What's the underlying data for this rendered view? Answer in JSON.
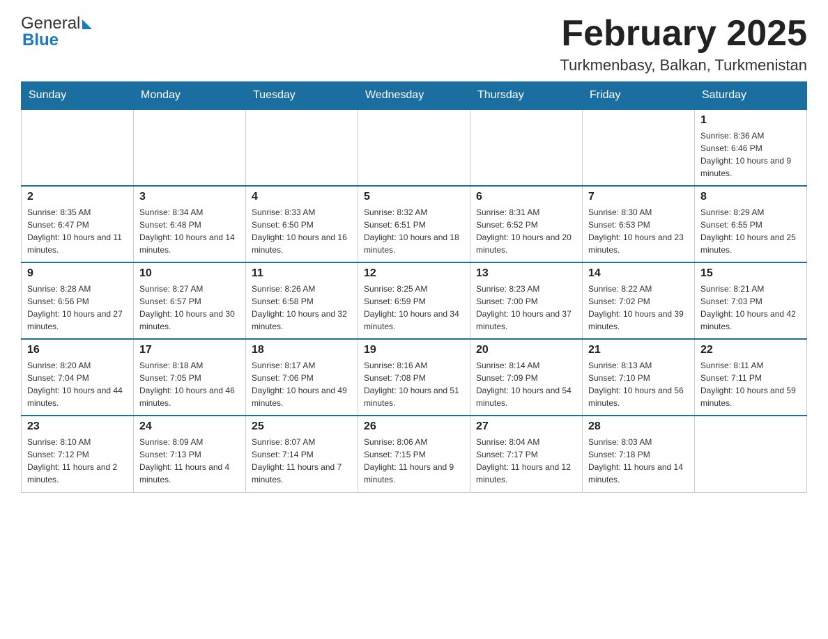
{
  "header": {
    "logo_general": "General",
    "logo_blue": "Blue",
    "month_title": "February 2025",
    "location": "Turkmenbasy, Balkan, Turkmenistan"
  },
  "weekdays": [
    "Sunday",
    "Monday",
    "Tuesday",
    "Wednesday",
    "Thursday",
    "Friday",
    "Saturday"
  ],
  "weeks": [
    [
      {
        "day": "",
        "info": ""
      },
      {
        "day": "",
        "info": ""
      },
      {
        "day": "",
        "info": ""
      },
      {
        "day": "",
        "info": ""
      },
      {
        "day": "",
        "info": ""
      },
      {
        "day": "",
        "info": ""
      },
      {
        "day": "1",
        "info": "Sunrise: 8:36 AM\nSunset: 6:46 PM\nDaylight: 10 hours and 9 minutes."
      }
    ],
    [
      {
        "day": "2",
        "info": "Sunrise: 8:35 AM\nSunset: 6:47 PM\nDaylight: 10 hours and 11 minutes."
      },
      {
        "day": "3",
        "info": "Sunrise: 8:34 AM\nSunset: 6:48 PM\nDaylight: 10 hours and 14 minutes."
      },
      {
        "day": "4",
        "info": "Sunrise: 8:33 AM\nSunset: 6:50 PM\nDaylight: 10 hours and 16 minutes."
      },
      {
        "day": "5",
        "info": "Sunrise: 8:32 AM\nSunset: 6:51 PM\nDaylight: 10 hours and 18 minutes."
      },
      {
        "day": "6",
        "info": "Sunrise: 8:31 AM\nSunset: 6:52 PM\nDaylight: 10 hours and 20 minutes."
      },
      {
        "day": "7",
        "info": "Sunrise: 8:30 AM\nSunset: 6:53 PM\nDaylight: 10 hours and 23 minutes."
      },
      {
        "day": "8",
        "info": "Sunrise: 8:29 AM\nSunset: 6:55 PM\nDaylight: 10 hours and 25 minutes."
      }
    ],
    [
      {
        "day": "9",
        "info": "Sunrise: 8:28 AM\nSunset: 6:56 PM\nDaylight: 10 hours and 27 minutes."
      },
      {
        "day": "10",
        "info": "Sunrise: 8:27 AM\nSunset: 6:57 PM\nDaylight: 10 hours and 30 minutes."
      },
      {
        "day": "11",
        "info": "Sunrise: 8:26 AM\nSunset: 6:58 PM\nDaylight: 10 hours and 32 minutes."
      },
      {
        "day": "12",
        "info": "Sunrise: 8:25 AM\nSunset: 6:59 PM\nDaylight: 10 hours and 34 minutes."
      },
      {
        "day": "13",
        "info": "Sunrise: 8:23 AM\nSunset: 7:00 PM\nDaylight: 10 hours and 37 minutes."
      },
      {
        "day": "14",
        "info": "Sunrise: 8:22 AM\nSunset: 7:02 PM\nDaylight: 10 hours and 39 minutes."
      },
      {
        "day": "15",
        "info": "Sunrise: 8:21 AM\nSunset: 7:03 PM\nDaylight: 10 hours and 42 minutes."
      }
    ],
    [
      {
        "day": "16",
        "info": "Sunrise: 8:20 AM\nSunset: 7:04 PM\nDaylight: 10 hours and 44 minutes."
      },
      {
        "day": "17",
        "info": "Sunrise: 8:18 AM\nSunset: 7:05 PM\nDaylight: 10 hours and 46 minutes."
      },
      {
        "day": "18",
        "info": "Sunrise: 8:17 AM\nSunset: 7:06 PM\nDaylight: 10 hours and 49 minutes."
      },
      {
        "day": "19",
        "info": "Sunrise: 8:16 AM\nSunset: 7:08 PM\nDaylight: 10 hours and 51 minutes."
      },
      {
        "day": "20",
        "info": "Sunrise: 8:14 AM\nSunset: 7:09 PM\nDaylight: 10 hours and 54 minutes."
      },
      {
        "day": "21",
        "info": "Sunrise: 8:13 AM\nSunset: 7:10 PM\nDaylight: 10 hours and 56 minutes."
      },
      {
        "day": "22",
        "info": "Sunrise: 8:11 AM\nSunset: 7:11 PM\nDaylight: 10 hours and 59 minutes."
      }
    ],
    [
      {
        "day": "23",
        "info": "Sunrise: 8:10 AM\nSunset: 7:12 PM\nDaylight: 11 hours and 2 minutes."
      },
      {
        "day": "24",
        "info": "Sunrise: 8:09 AM\nSunset: 7:13 PM\nDaylight: 11 hours and 4 minutes."
      },
      {
        "day": "25",
        "info": "Sunrise: 8:07 AM\nSunset: 7:14 PM\nDaylight: 11 hours and 7 minutes."
      },
      {
        "day": "26",
        "info": "Sunrise: 8:06 AM\nSunset: 7:15 PM\nDaylight: 11 hours and 9 minutes."
      },
      {
        "day": "27",
        "info": "Sunrise: 8:04 AM\nSunset: 7:17 PM\nDaylight: 11 hours and 12 minutes."
      },
      {
        "day": "28",
        "info": "Sunrise: 8:03 AM\nSunset: 7:18 PM\nDaylight: 11 hours and 14 minutes."
      },
      {
        "day": "",
        "info": ""
      }
    ]
  ]
}
